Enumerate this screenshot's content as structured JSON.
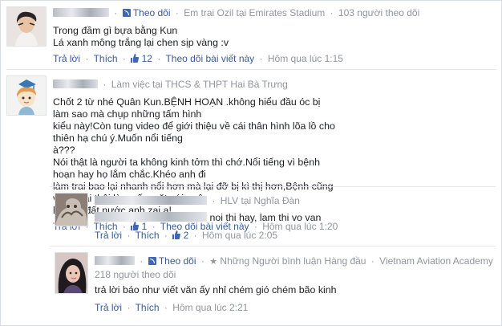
{
  "comments": [
    {
      "follow": "Theo dõi",
      "subtitle": "Em trai Ozil tại Emirates Stadium",
      "followers": "103 người theo dõi",
      "lines": [
        "Trong đầm gì bựa bằng Kun",
        "Lá xanh mông trắng lại chen sịp vàng :v"
      ],
      "reply": "Trả lời",
      "like": "Thích",
      "likes": "12",
      "follow_post": "Theo dõi bài viết này",
      "time": "Hôm qua lúc 1:15"
    },
    {
      "subtitle": "Làm việc tại THCS & THPT Hai Bà Trưng",
      "lines": [
        "Chốt 2 từ nhé Quân Kun.BỆNH HOẠN .không hiểu đầu óc bị làm sao mà chụp những tấm hình",
        "kiểu này!Còn tung video để giới thiệu về cái thân hình lõa lồ cho thiên hạ chú ý.Muốn nổi tiếng",
        "à???",
        "Nói thật là người ta không kinh tởm thì chớ.Nổi tiếng vì bệnh hoạn hay họ lắm chắc.Khéo anh đi",
        "làm trai bao lại nhanh nổi hơn mà lại đỡ bị kì thị hơn,Bệnh cũng vừa phải thôi,làm xấu mặt với quê",
        "hương đất nước anh zai ạ!"
      ],
      "reply": "Trả lời",
      "like": "Thích",
      "likes": "1",
      "follow_post": "Theo dõi bài viết này",
      "time": "Hôm qua lúc 1:20"
    }
  ],
  "replies": [
    {
      "subtitle": "HLV tại Nghĩa Đàn",
      "text": "noi thi hay, lam thi vo van",
      "reply": "Trả lời",
      "like": "Thích",
      "likes": "2",
      "time": "Hôm qua lúc 2:05"
    },
    {
      "follow": "Theo dõi",
      "badge": "Những Người bình luận Hàng đầu",
      "workplace": "Vietnam Aviation Academy",
      "followers": "218 người theo dõi",
      "text": "trả lời báo như viết văn ấy nhỉ chém gió chém bão kinh",
      "reply": "Trả lời",
      "like": "Thích",
      "time": "Hôm qua lúc 2:21"
    }
  ],
  "colors": {
    "link": "#3b5998",
    "meta": "#90949c",
    "text": "#1c1e21"
  },
  "icons": [
    "rss-follow-icon",
    "like-thumb-icon",
    "star-icon"
  ]
}
